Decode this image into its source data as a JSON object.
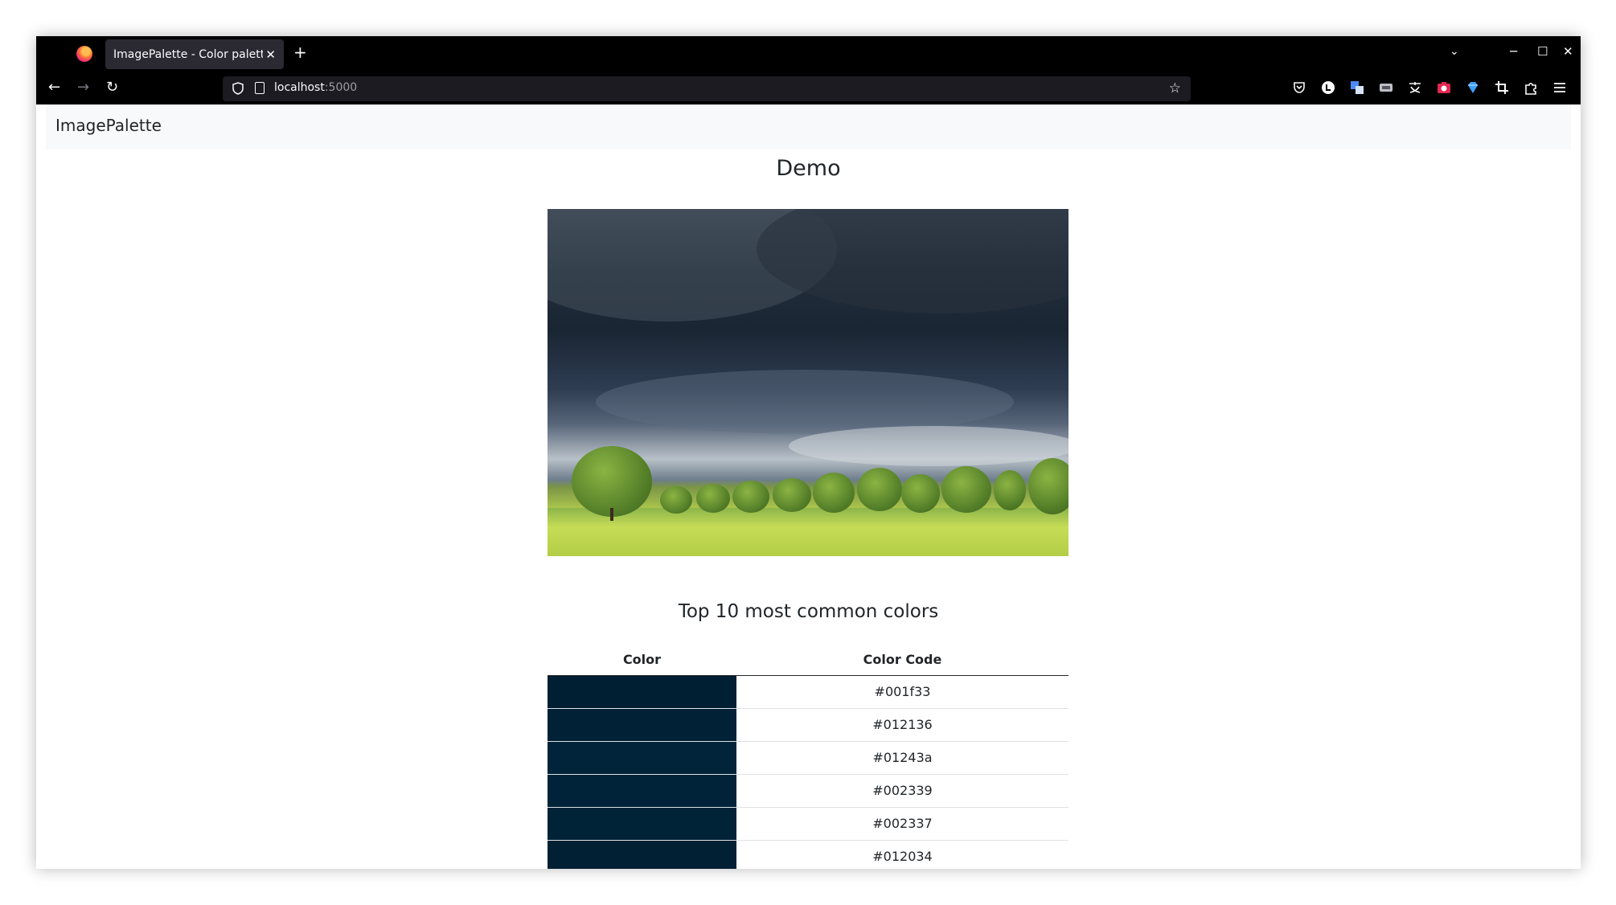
{
  "browser": {
    "tab_title": "ImagePalette - Color palette generator",
    "tab_close": "✕",
    "new_tab": "+",
    "tab_list": "⌄",
    "minimize": "─",
    "maximize": "☐",
    "close": "✕",
    "back": "←",
    "forward": "→",
    "reload": "↻",
    "url_host": "localhost",
    "url_port": ":5000",
    "bookmark": "☆"
  },
  "navbar": {
    "brand": "ImagePalette"
  },
  "main": {
    "heading": "Demo",
    "colors_heading": "Top 10 most common colors",
    "columns": [
      "Color",
      "Color Code"
    ],
    "rows": [
      {
        "color": "#001f33",
        "code": "#001f33"
      },
      {
        "color": "#012136",
        "code": "#012136"
      },
      {
        "color": "#01243a",
        "code": "#01243a"
      },
      {
        "color": "#002339",
        "code": "#002339"
      },
      {
        "color": "#002337",
        "code": "#002337"
      },
      {
        "color": "#012034",
        "code": "#012034"
      }
    ]
  }
}
